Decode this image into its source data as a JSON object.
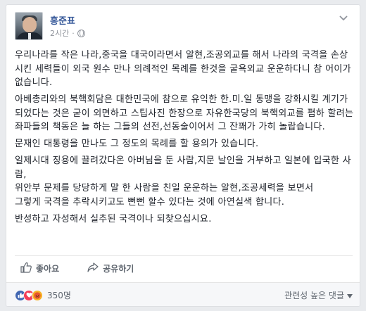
{
  "post": {
    "author": "홍준표",
    "time": "2시간",
    "privacy_icon": "globe-icon",
    "menu_icon": "chevron-down-icon",
    "paragraphs": [
      "우리나라를 작은 나라,중국을 대국이라면서 알현,조공외교를 해서 나라의 국격을 손상시킨 세력들이 외국 원수 만나 의례적인 목례를 한것을 굴욕외교 운운하다니 참 어이가 없습니다.",
      "아베총리와의 북핵회담은 대한민국에 참으로 유익한 한.미.일 동맹을 강화시킬 계기가 되었다는 것은 굳이 외면하고 스팁사진 한장으로 자유한국당의 북핵외교를 폄하 할려는 좌파들의 책동은 늘 하는 그들의 선전,선동술이어서 그 잔꽤가 가히 놀랍습니다.",
      "문재인 대통령을 만나도 그 정도의 목례를 할 용의가 있습니다.",
      "일제시대 징용에 끌려갔다온 아버님을 둔 사람,지문 날인을 거부하고 일본에 입국한 사람,\n위안부 문제를 당당하게 말 한 사람을 친일 운운하는 알현,조공세력을 보면서\n그렇게 국격을 추락시키고도 뻔뻔 할수 있다는 것에 아연실색 합니다.",
      "반성하고 자성해서 실추된 국격이나 되찾으십시요."
    ]
  },
  "actions": {
    "like_label": "좋아요",
    "share_label": "공유하기"
  },
  "reactions": {
    "count": "350명",
    "sort_label": "관련성 높은 댓글"
  },
  "colors": {
    "link": "#365899",
    "like": "#4267b2",
    "love": "#f33e58",
    "angry": "#f7b125"
  }
}
